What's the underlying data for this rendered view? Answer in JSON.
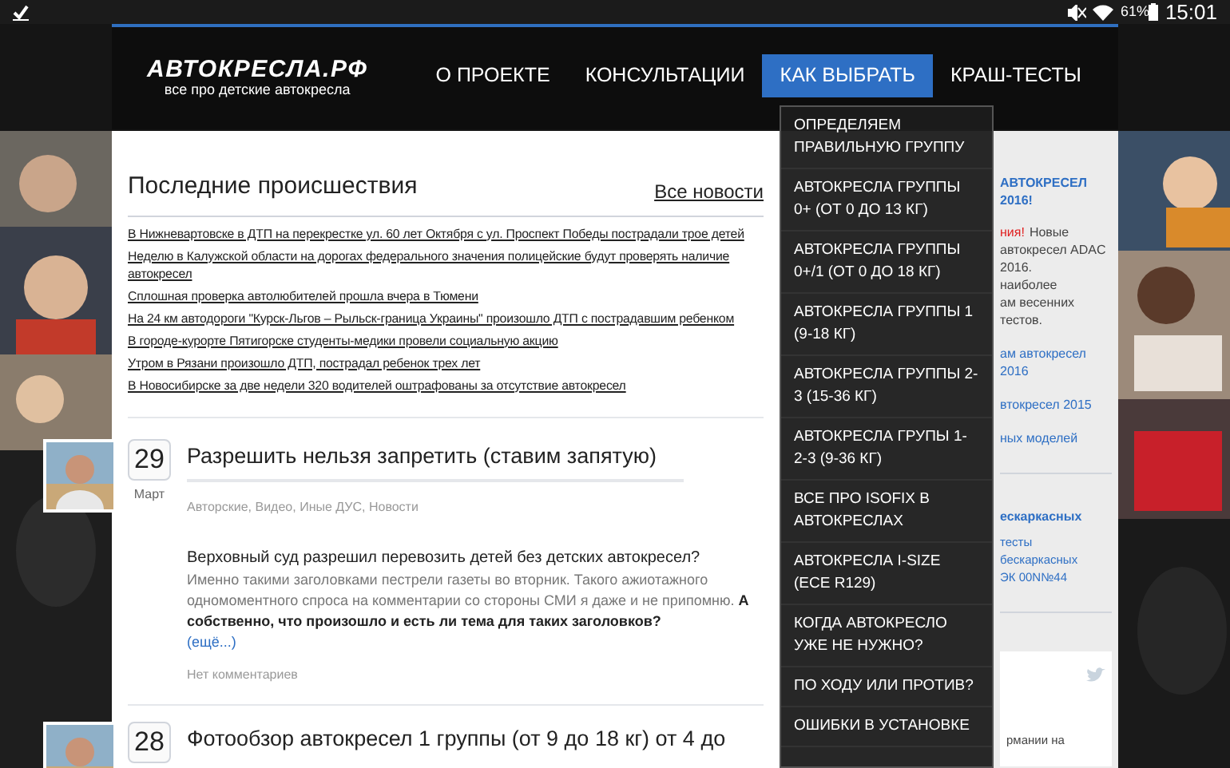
{
  "status_bar": {
    "battery": "61%",
    "time": "15:01"
  },
  "header": {
    "logo": "АВТОКРЕСЛА.РФ",
    "tagline": "все про детские автокресла",
    "nav": [
      {
        "label": "О ПРОЕКТЕ",
        "selected": false
      },
      {
        "label": "КОНСУЛЬТАЦИИ",
        "selected": false
      },
      {
        "label": "КАК ВЫБРАТЬ",
        "selected": true
      },
      {
        "label": "КРАШ-ТЕСТЫ",
        "selected": false
      }
    ]
  },
  "dropdown": [
    "ОПРЕДЕЛЯЕМ ПРАВИЛЬНУЮ ГРУППУ",
    "АВТОКРЕСЛА ГРУППЫ 0+ (ОТ 0 ДО 13 КГ)",
    "АВТОКРЕСЛА ГРУППЫ 0+/1 (ОТ 0 ДО 18 КГ)",
    "АВТОКРЕСЛА ГРУППЫ 1 (9-18 КГ)",
    "АВТОКРЕСЛА ГРУППЫ 2-3 (15-36 КГ)",
    "АВТОКРЕСЛА ГРУПЫ 1-2-3 (9-36 КГ)",
    "ВСЕ ПРО ISOFIX В АВТОКРЕСЛАХ",
    "АВТОКРЕСЛА I-SIZE (ECE R129)",
    "КОГДА АВТОКРЕСЛО УЖЕ НЕ НУЖНО?",
    "ПО ХОДУ ИЛИ ПРОТИВ?",
    "ОШИБКИ В УСТАНОВКЕ"
  ],
  "incidents": {
    "title": "Последние происшествия",
    "all_link": "Все новости",
    "items": [
      "В Нижневартовске в ДТП на перекрестке ул. 60 лет Октября с ул. Проспект Победы пострадали трое детей",
      "Неделю в Калужской области на дорогах федерального значения полицейские будут проверять наличие автокресел",
      "Сплошная проверка автолюбителей прошла вчера в Тюмени",
      "На 24 км автодороги \"Курск-Льгов – Рыльск-граница Украины\" произошло ДТП с пострадавшим ребенком",
      "В городе-курорте Пятигорске студенты-медики провели социальную акцию",
      "Утром в Рязани произошло ДТП, пострадал ребенок трех лет",
      "В Новосибирске за две недели 320 водителей оштрафованы за отсутствие автокресел"
    ]
  },
  "posts": [
    {
      "day": "29",
      "month": "Март",
      "title": "Разрешить нельзя запретить (ставим запятую)",
      "categories": "Авторские, Видео, Иные ДУС, Новости",
      "lead": "Верховный суд разрешил перевозить детей без детских автокресел?",
      "excerpt": "Именно такими заголовками пестрели газеты во вторник. Такого ажиотажного одномоментного спроса на комментарии со стороны СМИ я даже и не припомню. **А собственно, что произошло и есть ли тема для таких заголовков?**",
      "more": "(ещё...)",
      "comments": "Нет комментариев"
    },
    {
      "day": "28",
      "title": "Фотообзор автокресел 1 группы (от 9 до 18 кг) от 4 до"
    }
  ],
  "sidebar": [
    {
      "kind": "heading",
      "text": "АВТОКРЕСЕЛ 2016!"
    },
    {
      "kind": "alert",
      "text": "ния!",
      "rest": "Новые"
    },
    {
      "kind": "text",
      "text": "автокресел ADAC 2016."
    },
    {
      "kind": "text",
      "text": "наиболее"
    },
    {
      "kind": "text",
      "text": "ам весенних тестов."
    },
    {
      "kind": "link",
      "text": "ам автокресел 2016"
    },
    {
      "kind": "link",
      "text": "втокресел 2015"
    },
    {
      "kind": "link",
      "text": "ных моделей"
    },
    {
      "kind": "divider"
    },
    {
      "kind": "heading",
      "text": "ескаркасных"
    },
    {
      "kind": "small_link",
      "text": "тесты бескаркасных"
    },
    {
      "kind": "small_link",
      "text": "ЭК 00N№44"
    },
    {
      "kind": "divider"
    },
    {
      "kind": "tweet",
      "text": "рмании на"
    }
  ]
}
